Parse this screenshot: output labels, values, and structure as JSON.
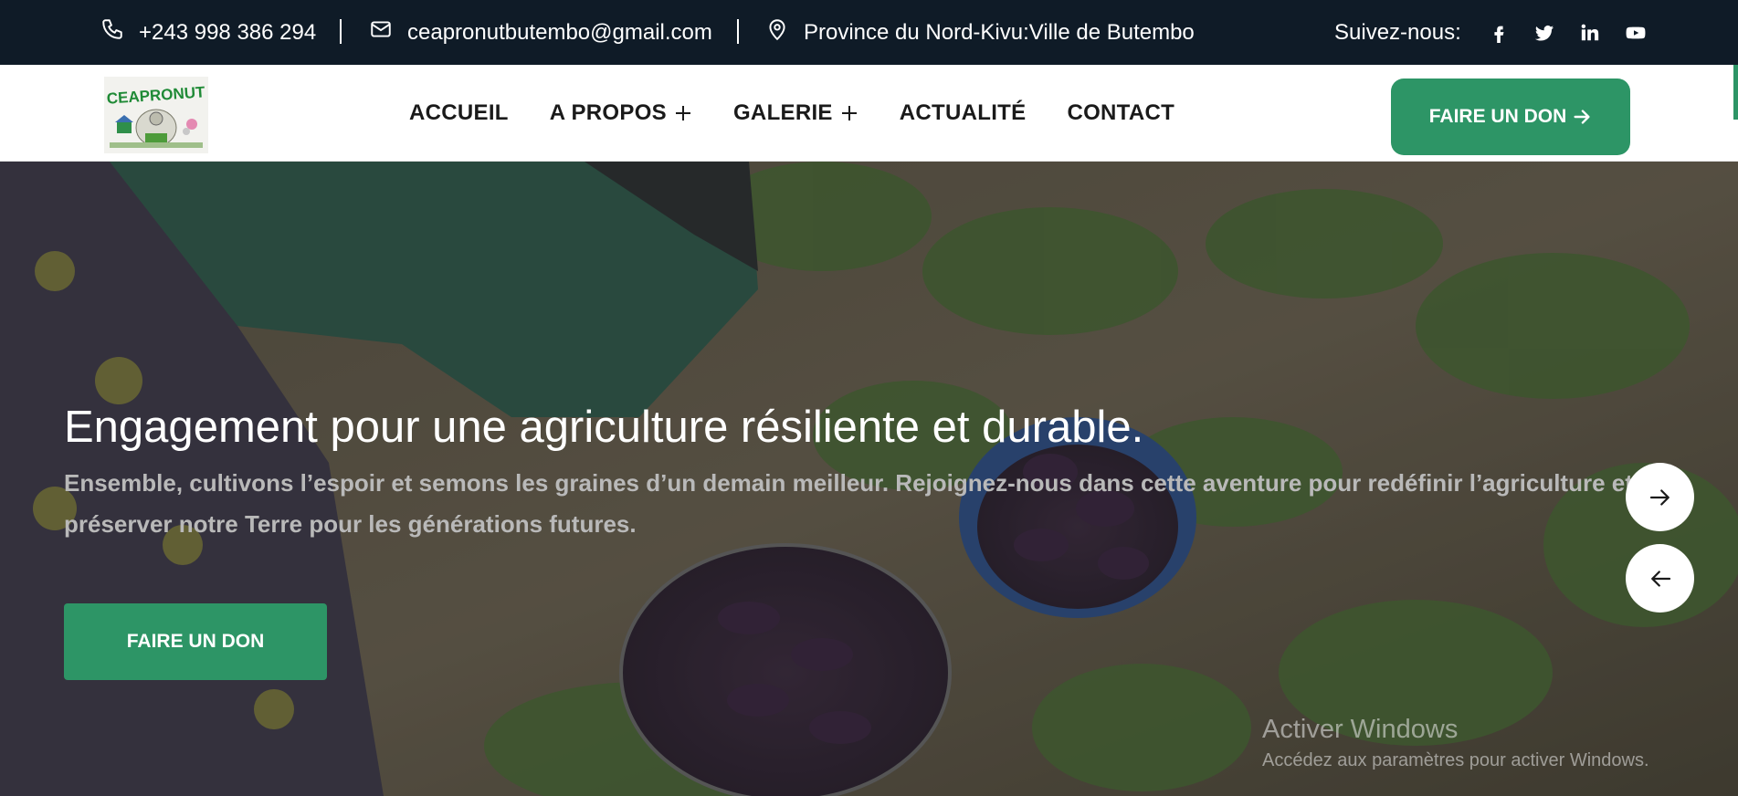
{
  "topbar": {
    "phone": "+243 998 386 294",
    "email": "ceapronutbutembo@gmail.com",
    "address": "Province du Nord-Kivu:Ville de Butembo",
    "follow_label": "Suivez-nous:",
    "social": [
      "facebook-icon",
      "twitter-icon",
      "linkedin-icon",
      "youtube-icon"
    ]
  },
  "header": {
    "logo_text": "CEAPRONUT",
    "nav": [
      {
        "label": "ACCUEIL",
        "has_submenu": false
      },
      {
        "label": "A PROPOS",
        "has_submenu": true
      },
      {
        "label": "GALERIE",
        "has_submenu": true
      },
      {
        "label": "ACTUALITÉ",
        "has_submenu": false
      },
      {
        "label": "CONTACT",
        "has_submenu": false
      }
    ],
    "donate_label": "FAIRE UN DON"
  },
  "hero": {
    "title": "Engagement pour une agriculture résiliente et durable.",
    "subtitle": "Ensemble, cultivons l’espoir et semons les graines d’un demain meilleur. Rejoignez-nous dans cette aventure pour redéfinir l’agriculture et préserver notre Terre pour les générations futures.",
    "donate_label": "FAIRE UN DON",
    "next_icon": "arrow-right-icon",
    "prev_icon": "arrow-left-icon"
  },
  "watermark": {
    "title": "Activer Windows",
    "subtitle": "Accédez aux paramètres pour activer Windows."
  },
  "colors": {
    "topbar_bg": "#0f1b27",
    "accent_green": "#2d9566",
    "header_bg": "#ffffff",
    "nav_text": "#1a1a1a"
  }
}
